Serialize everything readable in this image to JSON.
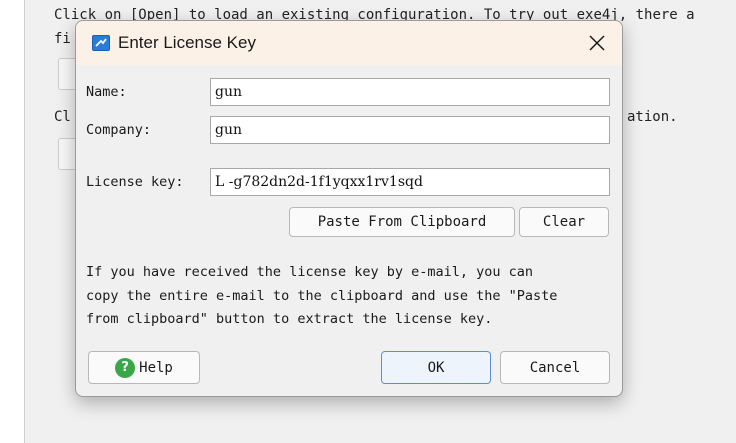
{
  "background": {
    "line1": "Click on [Open] to load an existing configuration. To try out exe4j, there a",
    "line2": "fi",
    "line3": "Cl",
    "line3_end": "ation."
  },
  "dialog": {
    "title": "Enter License Key",
    "fields": {
      "name_label": "Name:",
      "name_value": "gun",
      "company_label": "Company:",
      "company_value": "gun",
      "license_label": "License key:",
      "license_value": "L -g782dn2d-1f1yqxx1rv1sqd"
    },
    "buttons": {
      "paste": "Paste From Clipboard",
      "clear": "Clear",
      "help": "Help",
      "ok": "OK",
      "cancel": "Cancel"
    },
    "info_text": "If you have received the license key by e-mail, you can\ncopy the entire e-mail to the clipboard and use the \"Paste\nfrom clipboard\" button to extract the license key.",
    "icons": {
      "title": "window-app-icon",
      "close": "close-icon",
      "help": "help-question-icon"
    }
  }
}
